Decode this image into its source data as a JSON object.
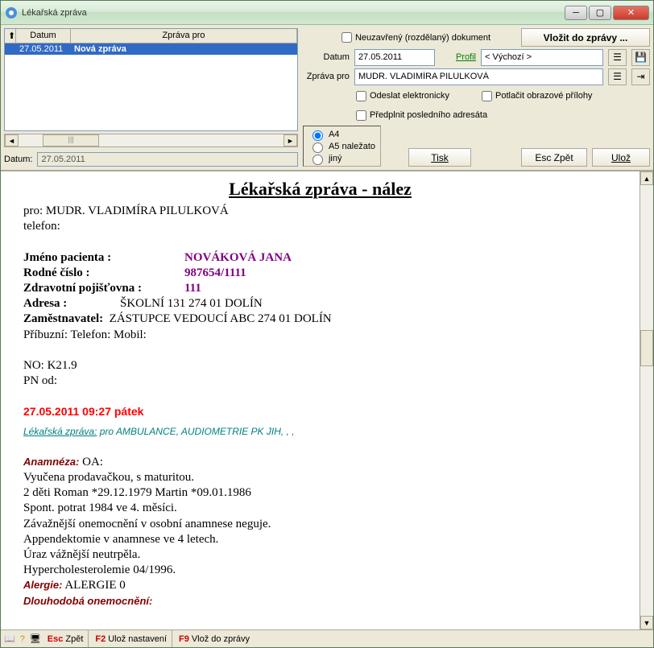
{
  "titlebar": {
    "title": "Lékařská zpráva"
  },
  "list": {
    "col0": "⬆",
    "col1": "Datum",
    "col2": "Zpráva pro",
    "rows": [
      {
        "date": "27.05.2011",
        "text": "Nová zpráva"
      }
    ],
    "scrollThumb": "|||"
  },
  "datum_label": "Datum:",
  "datum_value": "27.05.2011",
  "right": {
    "neuzavreny": "Neuzavřený (rozdělaný) dokument",
    "vlozit_btn": "Vložit do zprávy ...",
    "datum_label": "Datum",
    "datum_value": "27.05.2011",
    "profil_label": "Profil",
    "profil_value": "< Výchozí >",
    "zprava_pro_label": "Zpráva pro",
    "zprava_pro_value": "MUDR. VLADIMÍRA PILULKOVÁ",
    "odeslat": "Odeslat elektronicky",
    "potlacit": "Potlačit obrazové přílohy",
    "predplnit": "Předplnit posledního adresáta",
    "radio_a4": "A4",
    "radio_a5": "A5 naležato",
    "radio_jiny": "jiný",
    "tisk_btn": "Tisk",
    "zpet_btn": "Esc  Zpět",
    "uloz_btn": "Ulož"
  },
  "doc": {
    "title": "Lékařská zpráva - nález",
    "pro": "pro: MUDR. VLADIMÍRA PILULKOVÁ",
    "telefon": "telefon:",
    "jmeno_lbl": "Jméno pacienta :",
    "jmeno_val": "NOVÁKOVÁ JANA",
    "rc_lbl": "Rodné číslo :",
    "rc_val": "987654/1111",
    "poj_lbl": "Zdravotní pojišťovna :",
    "poj_val": "111",
    "adresa_lbl": "Adresa :",
    "adresa_val": "ŠKOLNÍ 131   274 01 DOLÍN",
    "zam_lbl": "Zaměstnavatel:",
    "zam_val": "ZÁSTUPCE VEDOUCÍ  ABC   274 01 DOLÍN",
    "pribuz": "Příbuzní:   Telefon:  Mobil:",
    "no": "NO:  K21.9",
    "pn": "PN od:",
    "timestamp": "27.05.2011 09:27 pátek",
    "lz_head": "Lékařská zpráva:",
    "lz_text": "  pro AMBULANCE, AUDIOMETRIE PK JIH, , ,",
    "anam_lbl": "Anamnéza:",
    "anam_oa": " OA:",
    "a1": "Vyučena prodavačkou, s maturitou.",
    "a2": "2 děti Roman *29.12.1979 Martin *09.01.1986",
    "a3": "Spont. potrat 1984 ve 4. měsíci.",
    "a4": "Závažnější onemocnění v osobní anamnese neguje.",
    "a5": "Appendektomie v anamnese ve 4 letech.",
    "a6": "Úraz vážnější neutrpěla.",
    "a7": "Hypercholesterolemie 04/1996.",
    "alergie_lbl": "Alergie:",
    "alergie_val": "  ALERGIE 0",
    "dlouho_lbl": "Dlouhodobá onemocnění:"
  },
  "status": {
    "esc": "Esc",
    "zpet": "Zpět",
    "f2": "F2",
    "uloz": "Ulož nastavení",
    "f9": "F9",
    "vloz": "Vlož do zprávy"
  }
}
